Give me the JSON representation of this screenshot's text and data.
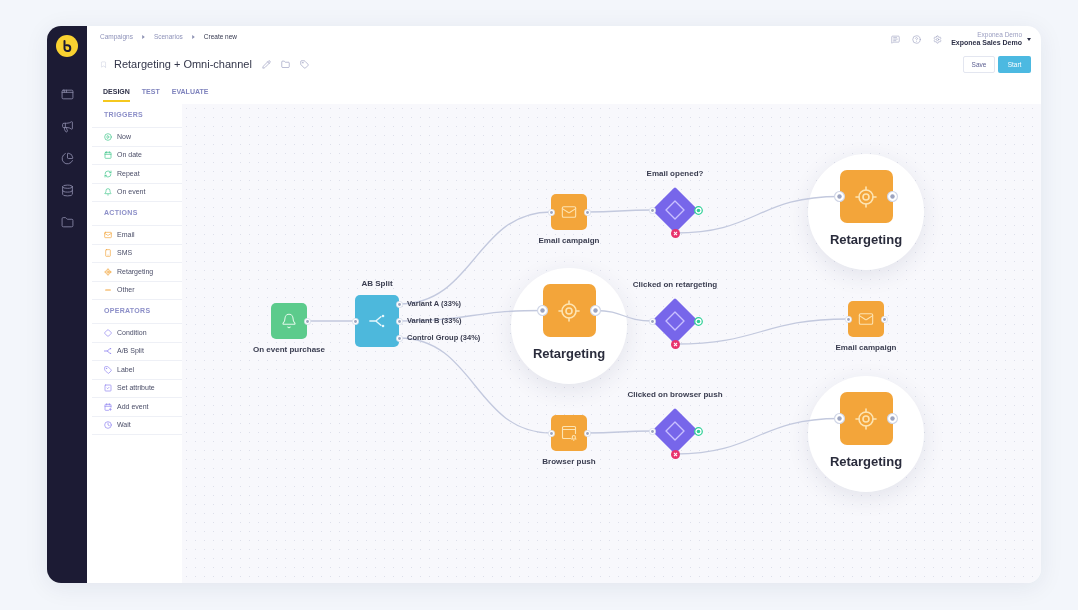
{
  "breadcrumb": [
    {
      "label": "Campaigns",
      "current": false
    },
    {
      "label": "Scenarios",
      "current": false
    },
    {
      "label": "Create new",
      "current": true
    }
  ],
  "scenario": {
    "title": "Retargeting + Omni-channel"
  },
  "tabs": [
    {
      "label": "DESIGN",
      "selected": true
    },
    {
      "label": "TEST",
      "selected": false
    },
    {
      "label": "EVALUATE",
      "selected": false
    }
  ],
  "account": {
    "project": "Exponea Demo",
    "name": "Exponea Sales Demo"
  },
  "buttons": [
    {
      "label": "Save",
      "kind": "secondary"
    },
    {
      "label": "Start",
      "kind": "primary"
    }
  ],
  "palette": [
    {
      "title": "TRIGGERS",
      "kind": "trigger",
      "items": [
        "Now",
        "On date",
        "Repeat",
        "On event"
      ]
    },
    {
      "title": "ACTIONS",
      "kind": "action",
      "items": [
        "Email",
        "SMS",
        "Retargeting",
        "Other"
      ]
    },
    {
      "title": "OPERATORS",
      "kind": "operator",
      "items": [
        "Condition",
        "A/B Split",
        "Label",
        "Set attribute",
        "Add event",
        "Wait"
      ]
    }
  ],
  "canvas": {
    "nodes": [
      {
        "kind": "trigger",
        "label": "On event purchase",
        "highlighted": false
      },
      {
        "kind": "ab_split",
        "label": "AB Split",
        "highlighted": false,
        "outputs": [
          "Variant A (33%)",
          "Variant B (33%)",
          "Control Group (34%)"
        ]
      },
      {
        "kind": "email",
        "label": "Email campaign",
        "highlighted": false
      },
      {
        "kind": "retargeting",
        "label": "Retargeting",
        "highlighted": true
      },
      {
        "kind": "browser_push",
        "label": "Browser push",
        "highlighted": false
      },
      {
        "kind": "condition",
        "label": "Email opened?",
        "highlighted": false
      },
      {
        "kind": "condition",
        "label": "Clicked on retargeting",
        "highlighted": false
      },
      {
        "kind": "condition",
        "label": "Clicked on browser push",
        "highlighted": false
      },
      {
        "kind": "retargeting",
        "label": "Retargeting",
        "highlighted": true
      },
      {
        "kind": "email",
        "label": "Email campaign",
        "highlighted": false
      },
      {
        "kind": "retargeting",
        "label": "Retargeting",
        "highlighted": true
      }
    ]
  }
}
